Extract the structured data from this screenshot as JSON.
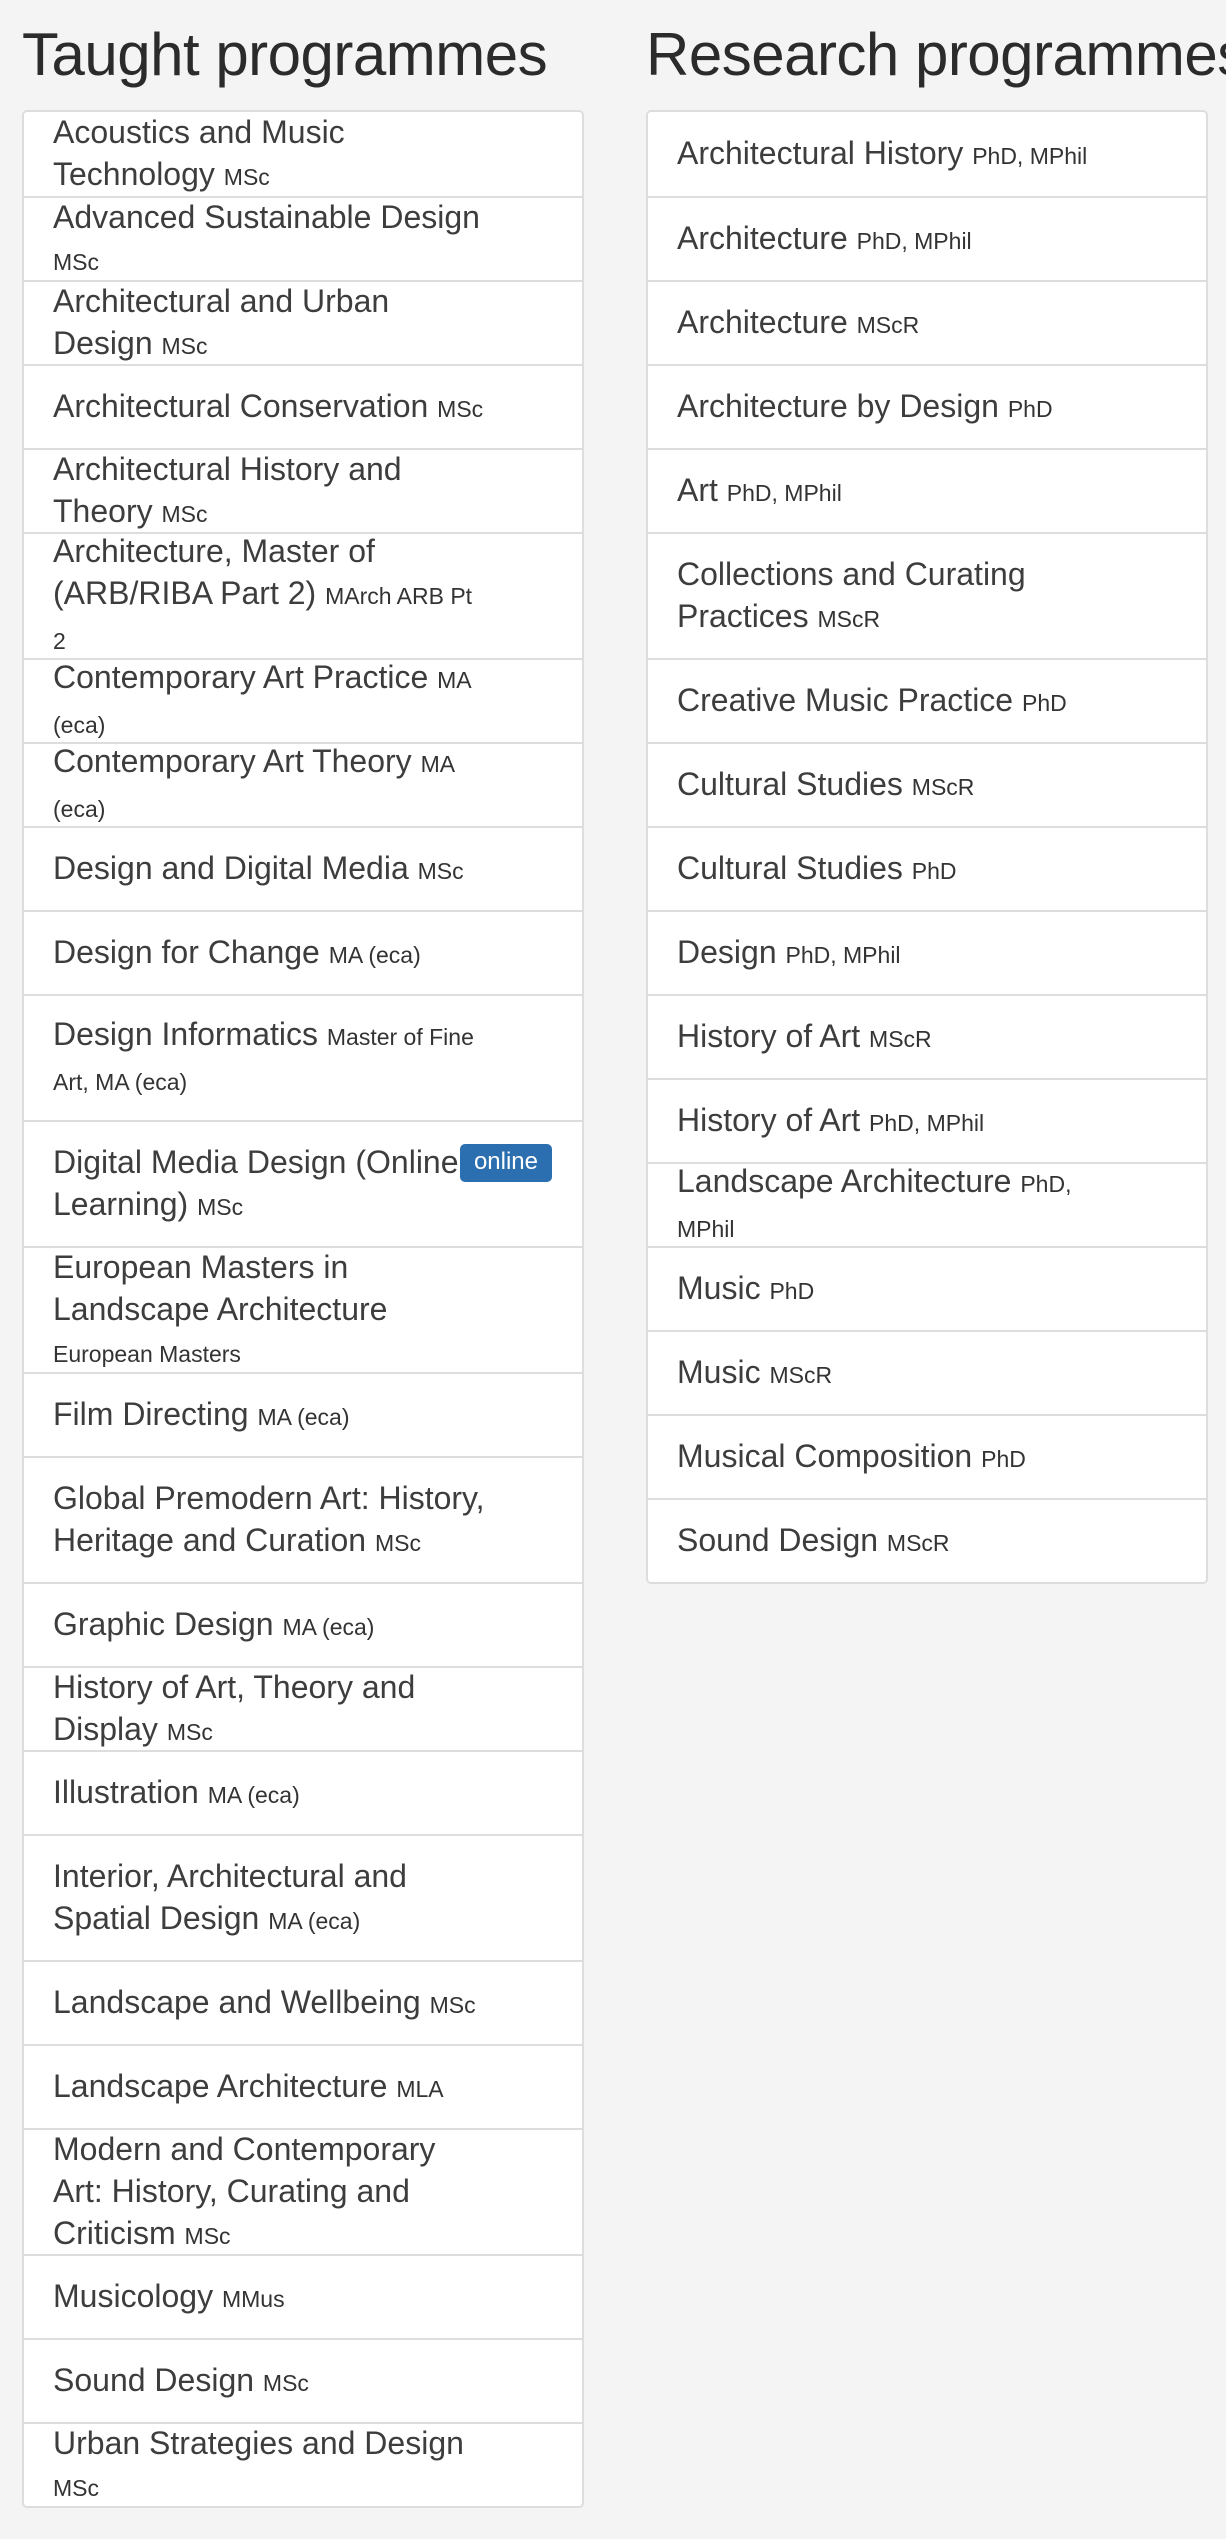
{
  "taught": {
    "title": "Taught programmes",
    "items": [
      {
        "name": "Acoustics and Music Technology",
        "award": "MSc"
      },
      {
        "name": "Advanced Sustainable Design",
        "award": "MSc"
      },
      {
        "name": "Architectural and Urban Design",
        "award": "MSc"
      },
      {
        "name": "Architectural Conservation",
        "award": "MSc"
      },
      {
        "name": "Architectural History and Theory",
        "award": "MSc"
      },
      {
        "name": "Architecture, Master of (ARB/RIBA Part 2)",
        "award": "MArch ARB Pt 2"
      },
      {
        "name": "Contemporary Art Practice",
        "award": "MA (eca)"
      },
      {
        "name": "Contemporary Art Theory",
        "award": "MA (eca)"
      },
      {
        "name": "Design and Digital Media",
        "award": "MSc"
      },
      {
        "name": "Design for Change",
        "award": "MA (eca)"
      },
      {
        "name": "Design Informatics",
        "award": "Master of Fine Art, MA (eca)"
      },
      {
        "name": "Digital Media Design (Online Learning)",
        "award": "MSc",
        "badge": "online"
      },
      {
        "name": "European Masters in Landscape Architecture",
        "award": "European Masters"
      },
      {
        "name": "Film Directing",
        "award": "MA (eca)"
      },
      {
        "name": "Global Premodern Art: History, Heritage and Curation",
        "award": "MSc"
      },
      {
        "name": "Graphic Design",
        "award": "MA (eca)"
      },
      {
        "name": "History of Art, Theory and Display",
        "award": "MSc"
      },
      {
        "name": "Illustration",
        "award": "MA (eca)"
      },
      {
        "name": "Interior, Architectural and Spatial Design",
        "award": "MA (eca)"
      },
      {
        "name": "Landscape and Wellbeing",
        "award": "MSc"
      },
      {
        "name": "Landscape Architecture",
        "award": "MLA"
      },
      {
        "name": "Modern and Contemporary Art: History, Curating and Criticism",
        "award": "MSc"
      },
      {
        "name": "Musicology",
        "award": "MMus"
      },
      {
        "name": "Sound Design",
        "award": "MSc"
      },
      {
        "name": "Urban Strategies and Design",
        "award": "MSc"
      }
    ]
  },
  "research": {
    "title": "Research programmes",
    "items": [
      {
        "name": "Architectural History",
        "award": "PhD, MPhil"
      },
      {
        "name": "Architecture",
        "award": "PhD, MPhil"
      },
      {
        "name": "Architecture",
        "award": "MScR"
      },
      {
        "name": "Architecture by Design",
        "award": "PhD"
      },
      {
        "name": "Art",
        "award": "PhD, MPhil"
      },
      {
        "name": "Collections and Curating Practices",
        "award": "MScR"
      },
      {
        "name": "Creative Music Practice",
        "award": "PhD"
      },
      {
        "name": "Cultural Studies",
        "award": "MScR"
      },
      {
        "name": "Cultural Studies",
        "award": "PhD"
      },
      {
        "name": "Design",
        "award": "PhD, MPhil"
      },
      {
        "name": "History of Art",
        "award": "MScR"
      },
      {
        "name": "History of Art",
        "award": "PhD, MPhil"
      },
      {
        "name": "Landscape Architecture",
        "award": "PhD, MPhil"
      },
      {
        "name": "Music",
        "award": "PhD"
      },
      {
        "name": "Music",
        "award": "MScR"
      },
      {
        "name": "Musical Composition",
        "award": "PhD"
      },
      {
        "name": "Sound Design",
        "award": "MScR"
      }
    ]
  }
}
